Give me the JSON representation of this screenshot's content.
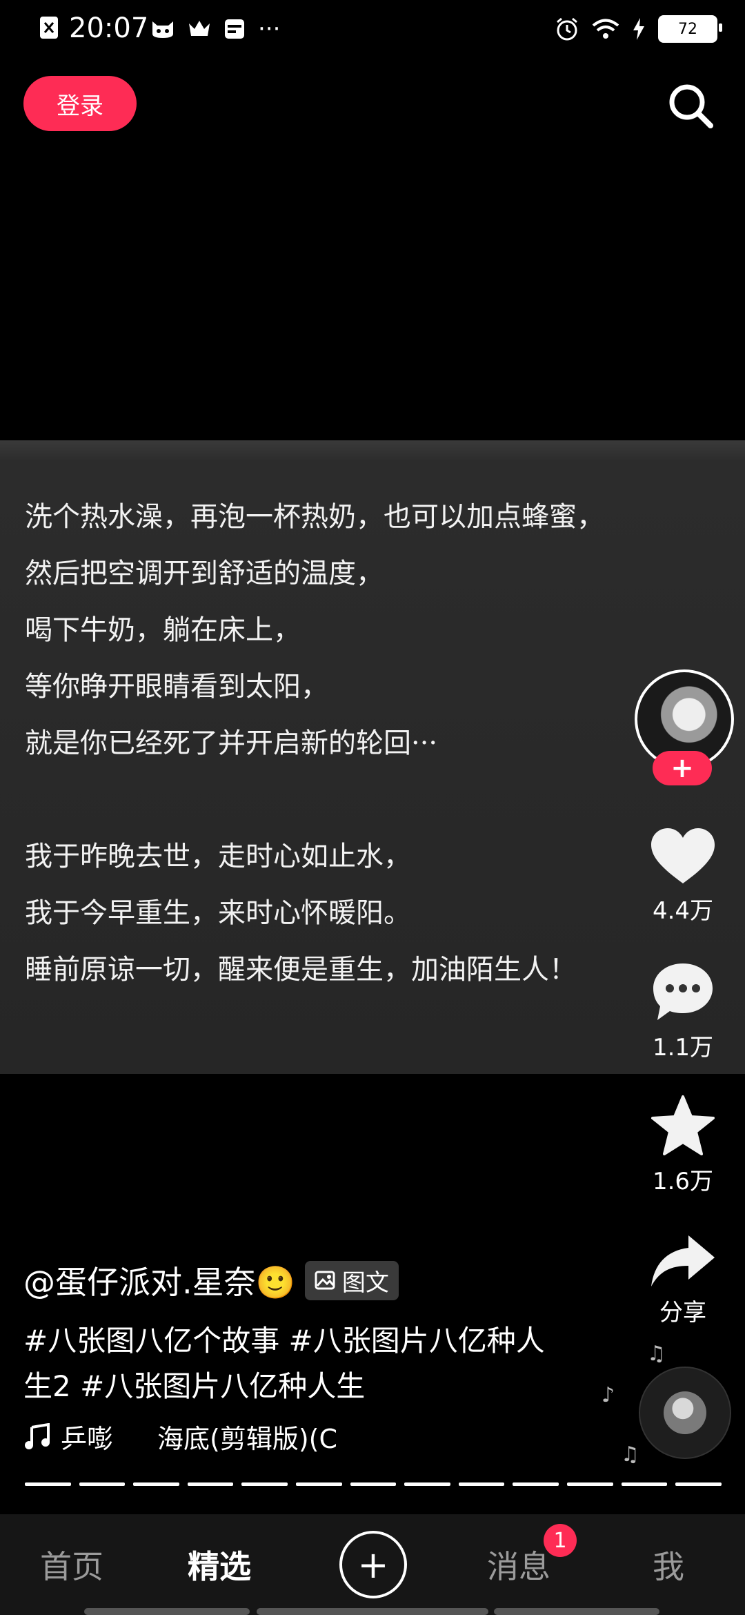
{
  "status_bar": {
    "time": "20:07",
    "battery": "72",
    "more": "···"
  },
  "top_bar": {
    "login_label": "登录"
  },
  "post": {
    "image_text": "洗个热水澡，再泡一杯热奶，也可以加点蜂蜜，\n然后把空调开到舒适的温度，\n喝下牛奶，躺在床上，\n等你睁开眼睛看到太阳，\n就是你已经死了并开启新的轮回···\n\n我于昨晚去世，走时心如止水，\n我于今早重生，来时心怀暖阳。\n睡前原谅一切，醒来便是重生，加油陌生人！",
    "author": "@蛋仔派对.星奈🙂",
    "type_badge": "图文",
    "hashtags": "#八张图八亿个故事 #八张图片八亿种人生2 #八张图片八亿种人生",
    "music_artist": "乒嘭",
    "music_track": "海底(剪辑版)(C"
  },
  "rail": {
    "likes": "4.4万",
    "comments": "1.1万",
    "favorites": "1.6万",
    "share": "分享"
  },
  "tabs": {
    "home": "首页",
    "featured": "精选",
    "messages": "消息",
    "message_badge": "1",
    "me": "我"
  },
  "colors": {
    "accent": "#fe2c55",
    "background": "#000000",
    "tabbar": "#161616"
  }
}
